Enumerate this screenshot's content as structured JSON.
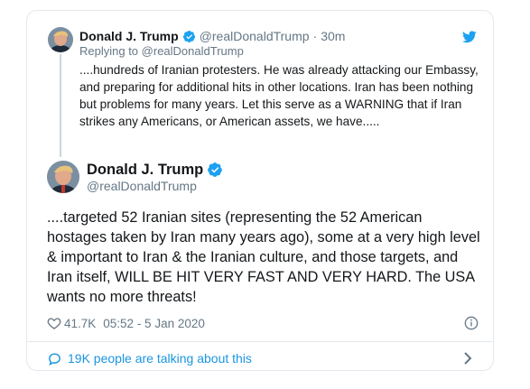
{
  "colors": {
    "accent": "#1da1f2",
    "link": "#1b95e0",
    "muted": "#657786",
    "text": "#14171a",
    "border": "#e1e8ed"
  },
  "parent_tweet": {
    "author_name": "Donald J. Trump",
    "author_handle": "@realDonaldTrump",
    "separator": "·",
    "time": "30m",
    "replying_prefix": "Replying to",
    "replying_handle": "@realDonaldTrump",
    "text": "....hundreds of Iranian protesters. He was already attacking our Embassy, and preparing for additional hits in other locations. Iran has been nothing but problems for many years. Let this serve as a WARNING that if Iran strikes any Americans, or American assets, we have....."
  },
  "main_tweet": {
    "author_name": "Donald J. Trump",
    "author_handle": "@realDonaldTrump",
    "text": "....targeted 52 Iranian sites (representing the 52 American hostages taken by Iran many years ago), some at a very high level & important to Iran &  the Iranian culture, and those targets, and Iran itself, WILL BE HIT VERY FAST AND VERY HARD. The USA wants no more threats!",
    "like_count": "41.7K",
    "timestamp": "05:52 - 5 Jan 2020"
  },
  "footer": {
    "talking_text": "19K people are talking about this"
  },
  "icons": {
    "verified": "verified-badge-icon",
    "twitter": "twitter-bird-icon",
    "like": "heart-icon",
    "info": "info-icon",
    "comment": "comment-bubble-icon",
    "chevron": "chevron-right-icon"
  }
}
